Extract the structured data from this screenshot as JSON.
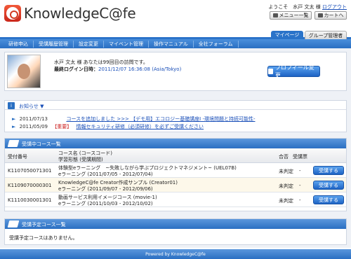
{
  "header": {
    "logo_text": "KnowledgeC@fe",
    "welcome": "ようこそ　水戸 文太 様",
    "logout": "ログアウト",
    "menu_button": "メニュー一覧",
    "cart_button": "カートへ"
  },
  "tabs": [
    {
      "label": "マイページ"
    },
    {
      "label": "グループ管理者"
    }
  ],
  "nav": [
    {
      "label": "研修申込"
    },
    {
      "label": "受講履歴管理"
    },
    {
      "label": "設定変更"
    },
    {
      "label": "マイベント管理"
    },
    {
      "label": "操作マニュアル"
    },
    {
      "label": "全社フォーラム"
    }
  ],
  "profile": {
    "visit_text": "水戸 文太 様 あなたは99回目の訪問です。",
    "last_login_label": "最終ログイン日時：",
    "last_login_value": "2011/12/07 16:36:08 (Asia/Tokyo)",
    "button": "プロフィール変更"
  },
  "notice": {
    "title": "お知らせ ▼",
    "items": [
      {
        "date": "2011/07/13",
        "tag": "",
        "text": "コースを追加しました >>> 【デモ用】エコロジー基礎講座Ⅰ -環境問題と持続可能性-"
      },
      {
        "date": "2011/05/09",
        "tag": "【重要】",
        "text": "情報セキュリティ研修（必須研修）を必ずご受講ください"
      }
    ]
  },
  "current_courses": {
    "title": "受講中コース一覧",
    "headers": {
      "id": "受付番号",
      "name": "コース名 (コースコード)",
      "form": "学習形態 (受講期間)",
      "result": "合否",
      "status": "受講票"
    },
    "rows": [
      {
        "id": "K1107050071301",
        "name": "体験型eラーニング　~失敗しながら学ぶプロジェクトマネジメント~ (UEL07B)",
        "form": "eラーニング (2011/07/05 - 2012/07/04)",
        "result": "未判定",
        "status": "-",
        "button": "受講する"
      },
      {
        "id": "K1109070000301",
        "name": "KnowledgeC@fe Creator作成サンプル (Creator01)",
        "form": "eラーニング (2011/09/07 - 2012/09/06)",
        "result": "未判定",
        "status": "-",
        "button": "受講する"
      },
      {
        "id": "K1110030001301",
        "name": "動画サービス利用イメージコース (movie-1)",
        "form": "eラーニング (2011/10/03 - 2012/10/02)",
        "result": "未判定",
        "status": "-",
        "button": "受講する"
      }
    ]
  },
  "planned_courses": {
    "title": "受講予定コース一覧",
    "empty_text": "受講予定コースはありません。"
  },
  "footer": {
    "text": "Powered by KnowledgeC@fe"
  },
  "colors": {
    "accent_blue": "#2a6fc2",
    "link_blue": "#1a4fb8",
    "important_red": "#cc2222",
    "logo_red": "#d23a22"
  }
}
